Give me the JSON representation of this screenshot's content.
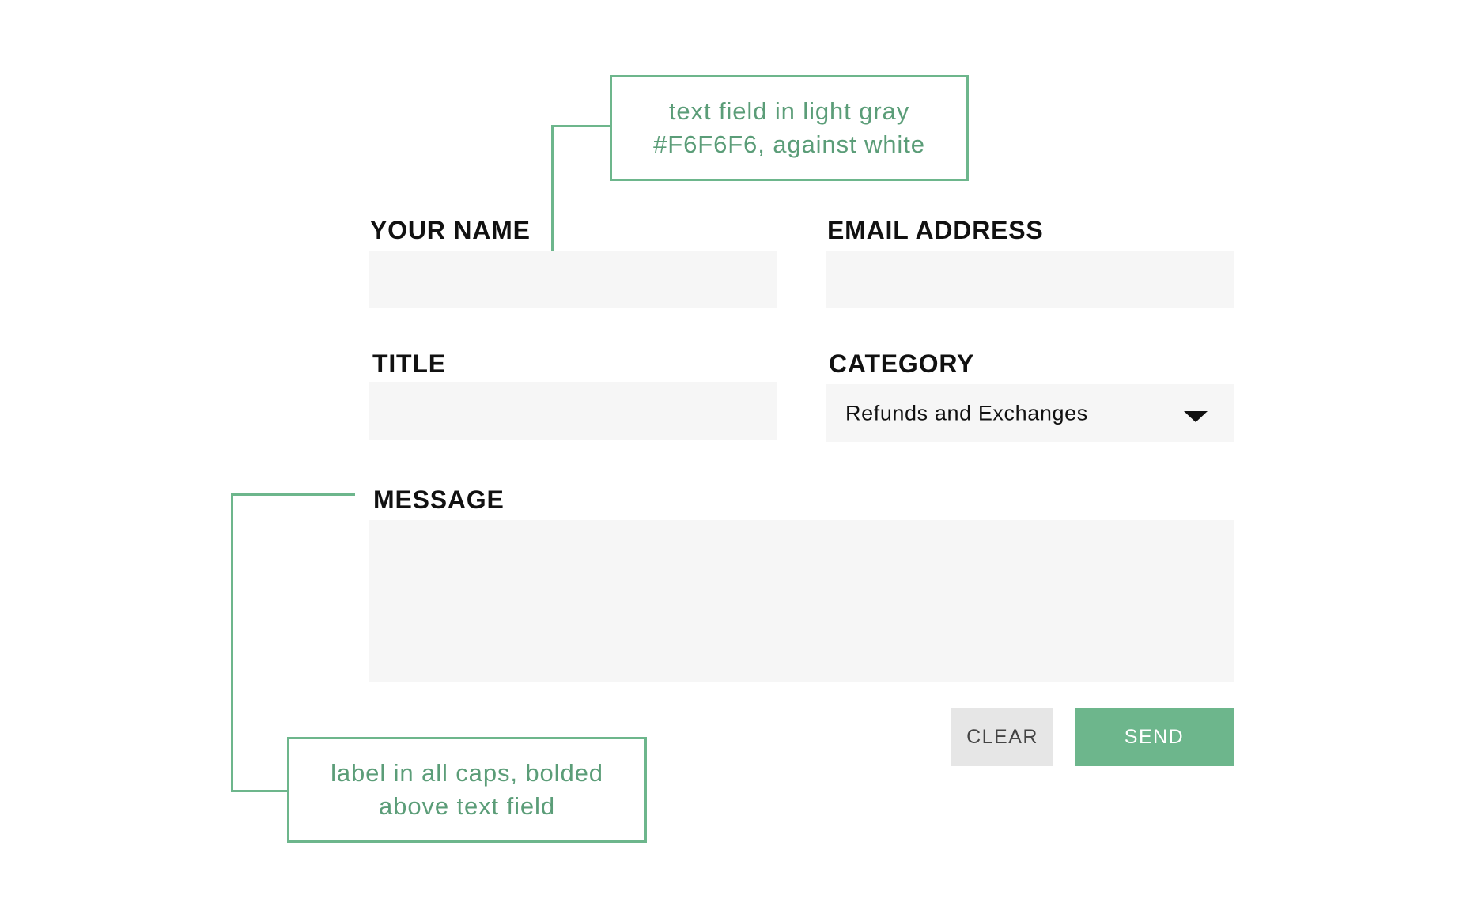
{
  "colors": {
    "accent": "#6DB68C",
    "field_bg": "#F6F6F6",
    "clear_bg": "#E6E6E6"
  },
  "form": {
    "name_label": "YOUR NAME",
    "name_value": "",
    "email_label": "EMAIL ADDRESS",
    "email_value": "",
    "title_label": "TITLE",
    "title_value": "",
    "category_label": "CATEGORY",
    "category_selected": "Refunds and Exchanges",
    "category_icon": "caret-down-icon",
    "message_label": "MESSAGE",
    "message_value": "",
    "clear_label": "CLEAR",
    "send_label": "SEND"
  },
  "annotations": {
    "field_note": {
      "line1": "text field in light gray",
      "line2": "#F6F6F6, against white"
    },
    "label_note": {
      "line1": "label in all caps, bolded",
      "line2": "above text field"
    }
  }
}
